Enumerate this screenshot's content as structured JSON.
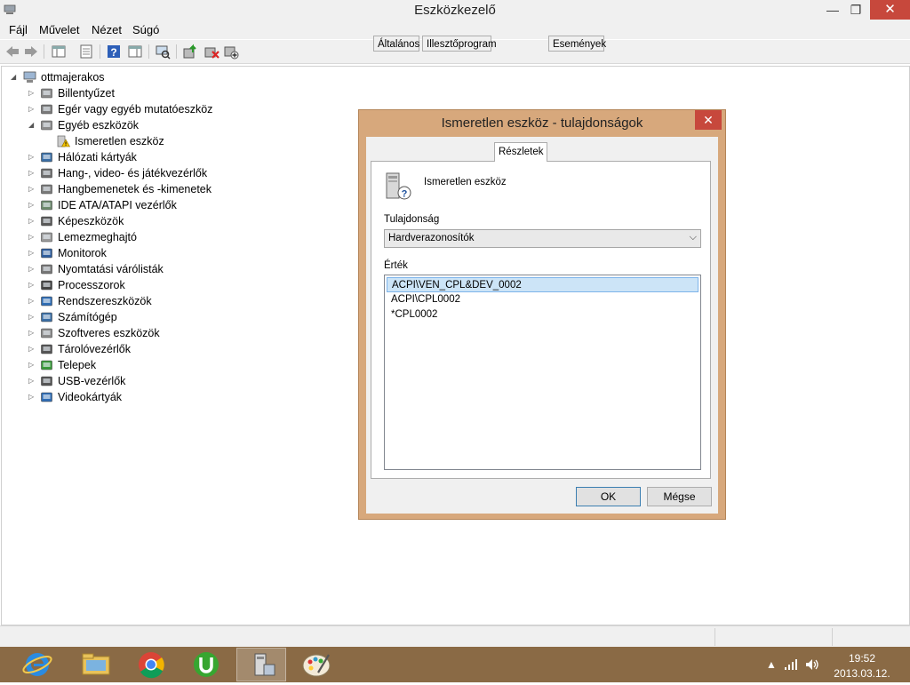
{
  "window": {
    "title": "Eszközkezelő",
    "controls": {
      "minimize": "—",
      "maximize": "❐",
      "close": "✕"
    }
  },
  "menu": [
    "Fájl",
    "Művelet",
    "Nézet",
    "Súgó"
  ],
  "toolbar": {
    "icons": [
      "back-icon",
      "forward-icon",
      "show-hide-console-tree-icon",
      "properties-icon",
      "help-icon",
      "action-pane-icon",
      "scan-hardware-icon",
      "update-driver-icon",
      "uninstall-icon",
      "add-legacy-hardware-icon"
    ]
  },
  "tree": {
    "root": "ottmajerakos",
    "nodes": [
      {
        "label": "Billentyűzet",
        "icon": "keyboard-icon",
        "state": "collapsed"
      },
      {
        "label": "Egér vagy egyéb mutatóeszköz",
        "icon": "mouse-icon",
        "state": "collapsed"
      },
      {
        "label": "Egyéb eszközök",
        "icon": "other-devices-icon",
        "state": "expanded"
      },
      {
        "label": "Ismeretlen eszköz",
        "icon": "unknown-device-warning-icon",
        "state": "child"
      },
      {
        "label": "Hálózati kártyák",
        "icon": "network-adapter-icon",
        "state": "collapsed"
      },
      {
        "label": "Hang-, video- és játékvezérlők",
        "icon": "sound-icon",
        "state": "collapsed"
      },
      {
        "label": "Hangbemenetek és -kimenetek",
        "icon": "audio-io-icon",
        "state": "collapsed"
      },
      {
        "label": "IDE ATA/ATAPI vezérlők",
        "icon": "ide-controller-icon",
        "state": "collapsed"
      },
      {
        "label": "Képeszközök",
        "icon": "imaging-device-icon",
        "state": "collapsed"
      },
      {
        "label": "Lemezmeghajtó",
        "icon": "disk-drive-icon",
        "state": "collapsed"
      },
      {
        "label": "Monitorok",
        "icon": "monitor-icon",
        "state": "collapsed"
      },
      {
        "label": "Nyomtatási várólisták",
        "icon": "printer-icon",
        "state": "collapsed"
      },
      {
        "label": "Processzorok",
        "icon": "processor-icon",
        "state": "collapsed"
      },
      {
        "label": "Rendszereszközök",
        "icon": "system-device-icon",
        "state": "collapsed"
      },
      {
        "label": "Számítógép",
        "icon": "computer-icon",
        "state": "collapsed"
      },
      {
        "label": "Szoftveres eszközök",
        "icon": "software-device-icon",
        "state": "collapsed"
      },
      {
        "label": "Tárolóvezérlők",
        "icon": "storage-controller-icon",
        "state": "collapsed"
      },
      {
        "label": "Telepek",
        "icon": "battery-icon",
        "state": "collapsed"
      },
      {
        "label": "USB-vezérlők",
        "icon": "usb-icon",
        "state": "collapsed"
      },
      {
        "label": "Videokártyák",
        "icon": "display-adapter-icon",
        "state": "collapsed"
      }
    ]
  },
  "dialog": {
    "title": "Ismeretlen eszköz - tulajdonságok",
    "tabs": [
      "Általános",
      "Illesztőprogram",
      "Részletek",
      "Események"
    ],
    "selected_tab": "Részletek",
    "device_name": "Ismeretlen eszköz",
    "property_label": "Tulajdonság",
    "property_value": "Hardverazonosítók",
    "value_label": "Érték",
    "values": [
      "ACPI\\VEN_CPL&DEV_0002",
      "ACPI\\CPL0002",
      "*CPL0002"
    ],
    "selected_value": "ACPI\\VEN_CPL&DEV_0002",
    "ok_label": "OK",
    "cancel_label": "Mégse",
    "close_glyph": "✕"
  },
  "taskbar": {
    "apps": [
      "internet-explorer-icon",
      "file-explorer-icon",
      "chrome-icon",
      "utorrent-icon",
      "device-manager-icon",
      "paint-icon"
    ],
    "active_app": "device-manager-icon",
    "time": "19:52",
    "date": "2013.03.12."
  },
  "colors": {
    "dialog_frame": "#d7a87c",
    "taskbar": "#8a6a45",
    "close_button": "#c7483c",
    "selection": "#cce4f7"
  }
}
